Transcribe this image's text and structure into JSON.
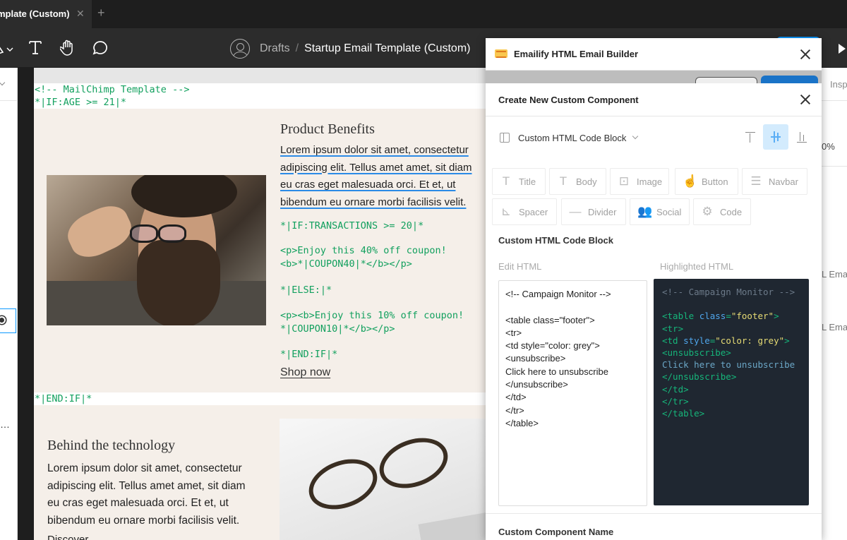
{
  "tabs": {
    "active": "mplate (Custom)",
    "close": "✕",
    "add": "+"
  },
  "toolbar": {
    "breadcrumb": {
      "root": "Drafts",
      "separator": "/",
      "file": "Startup Email Template (Custom)"
    }
  },
  "email": {
    "code_top": [
      "<!-- MailChimp Template -->",
      "*|IF:AGE >= 21|*"
    ],
    "section1": {
      "title": "Product Benefits",
      "body_lines": [
        "Lorem ipsum dolor sit amet, consectetur",
        "adipiscing elit. Tellus amet amet, sit diam",
        "eu cras eget malesuada orci. Et et, ut",
        "bibendum eu ornare morbi facilisis velit."
      ],
      "code": {
        "if": "*|IF:TRANSACTIONS >= 20|*",
        "offer40_a": "<p>Enjoy this 40% off coupon!",
        "offer40_b": "<b>*|COUPON40|*</b></p>",
        "else": "*|ELSE:|*",
        "offer10_a": "<p><b>Enjoy this 10% off coupon!",
        "offer10_b": "*|COUPON10|*</b></p>",
        "end": "*|END:IF|*"
      },
      "cta": "Shop now"
    },
    "end_if": "*|END:IF|*",
    "section2": {
      "title": "Behind the technology",
      "body_lines": [
        "Lorem ipsum dolor sit amet, consectetur",
        "adipiscing elit. Tellus amet amet, sit diam",
        "eu cras eget malesuada orci. Et et, ut",
        "bibendum eu ornare morbi facilisis velit."
      ],
      "more": "Discover"
    }
  },
  "right_panel": {
    "tab": "Insp",
    "percent": "0%",
    "ema1": "L Ema",
    "ema2": "L Ema"
  },
  "plugin": {
    "title": "Emailify HTML Email Builder",
    "modal": {
      "title": "Create New Custom Component",
      "component_type": "Custom HTML Code Block",
      "tiles": [
        "Title",
        "Body",
        "Image",
        "Button",
        "Navbar",
        "Spacer",
        "Divider",
        "Social",
        "Code"
      ],
      "block_title": "Custom HTML Code Block",
      "edit_label": "Edit HTML",
      "highlight_label": "Highlighted HTML",
      "edit_lines": [
        "<!-- Campaign Monitor -->",
        "",
        "<table class=\"footer\">",
        "<tr>",
        "<td style=\"color: grey\">",
        "<unsubscribe>",
        "Click here to unsubscribe",
        "</unsubscribe>",
        "</td>",
        "</tr>",
        "</table>"
      ],
      "highlight": {
        "comment": "<!-- Campaign Monitor -->",
        "table_open": "<table",
        "table_attr": "class",
        "table_eq": "=",
        "table_val": "\"footer\"",
        "table_close": ">",
        "tr_open": "<tr>",
        "td_open": "<td",
        "td_attr": "style",
        "td_eq": "=",
        "td_val_a": "\"color: ",
        "td_val_b": "grey",
        "td_val_c": "\"",
        "td_close": ">",
        "unsub_open": "<unsubscribe>",
        "text": "Click here to unsubscribe",
        "unsub_close": "</unsubscribe>",
        "td_end": "</td>",
        "tr_end": "</tr>",
        "table_end": "</table>"
      },
      "name_label": "Custom Component Name"
    }
  },
  "colors": {
    "accent": "#0d99ff",
    "code_green": "#12a05e",
    "editor_bg": "#1f2731",
    "align_selected": "#d3ebfd"
  }
}
